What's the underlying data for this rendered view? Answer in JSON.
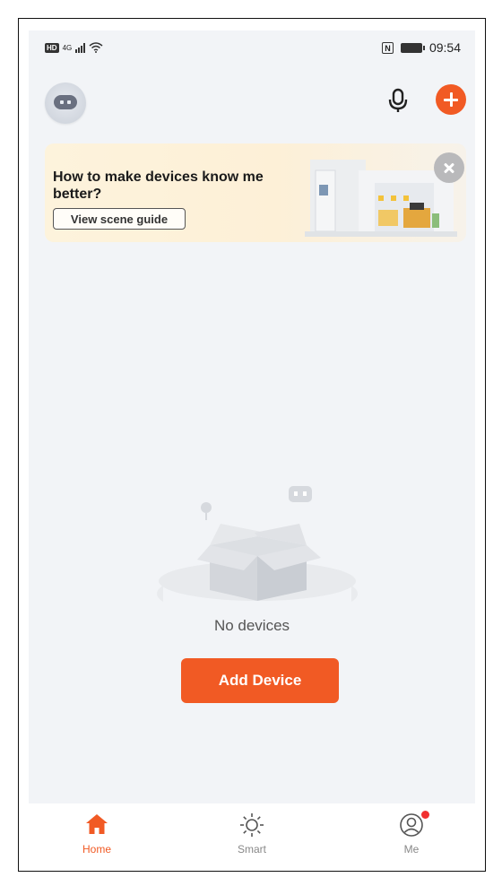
{
  "status_bar": {
    "hd": "HD",
    "network": "4G",
    "time": "09:54"
  },
  "banner": {
    "title": "How to make devices know me better?",
    "button_label": "View scene guide"
  },
  "empty_state": {
    "message": "No devices",
    "button_label": "Add Device"
  },
  "bottom_nav": {
    "items": [
      {
        "label": "Home",
        "icon": "home-icon",
        "active": true
      },
      {
        "label": "Smart",
        "icon": "sun-icon",
        "active": false
      },
      {
        "label": "Me",
        "icon": "user-icon",
        "active": false,
        "badge": true
      }
    ]
  },
  "colors": {
    "accent": "#f15a24",
    "background": "#f2f4f7",
    "banner_bg": "#fdf3dc",
    "badge": "#f12f2f"
  }
}
